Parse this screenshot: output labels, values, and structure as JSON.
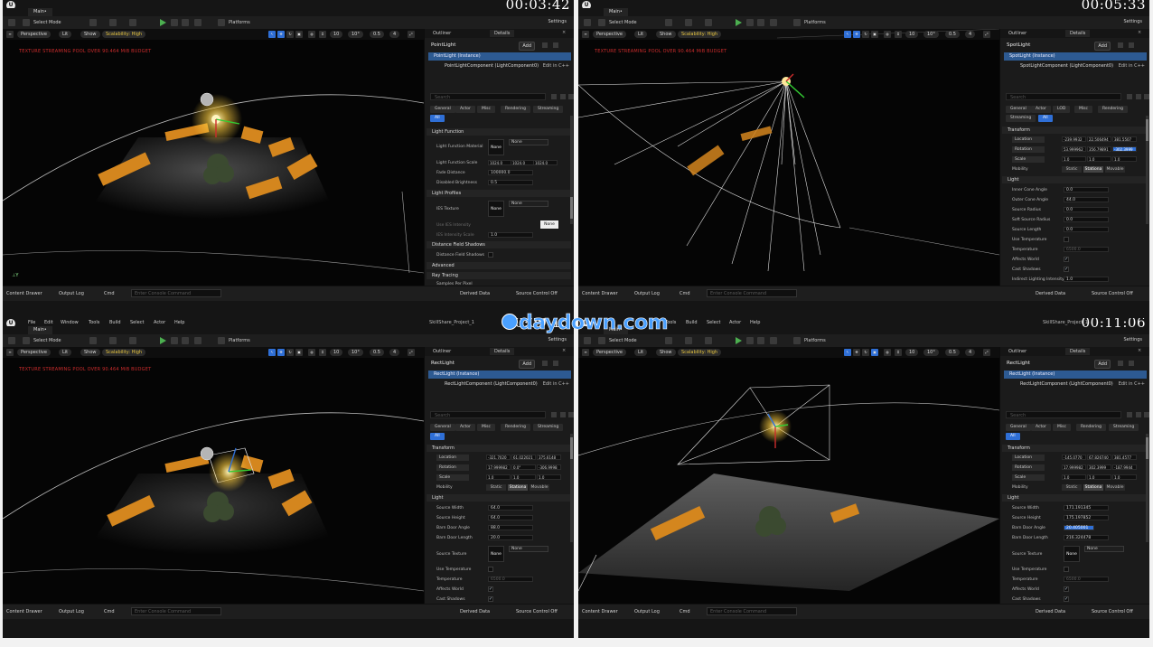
{
  "watermark": "daydown.com",
  "menu": [
    "File",
    "Edit",
    "Window",
    "Tools",
    "Build",
    "Select",
    "Actor",
    "Help"
  ],
  "project": "SkillShare_Project_1",
  "level_tab": "Main•",
  "toolbar": {
    "select_mode": "Select Mode",
    "platforms": "Platforms",
    "settings": "Settings"
  },
  "viewport": {
    "perspective": "Perspective",
    "lit": "Lit",
    "show": "Show",
    "scalability": "Scalability: High",
    "grid": "10",
    "angle": "10°",
    "scale": "0.5",
    "cam_speed": "4",
    "warning": "TEXTURE STREAMING POOL OVER 90.464 MiB BUDGET"
  },
  "panel": {
    "outliner": "Outliner",
    "details": "Details",
    "add": "Add",
    "search_placeholder": "Search",
    "edit_in_cpp": "Edit in C++"
  },
  "status": {
    "content_drawer": "Content Drawer",
    "output_log": "Output Log",
    "cmd": "Cmd",
    "console_placeholder": "Enter Console Command",
    "derived_data": "Derived Data",
    "source_control": "Source Control Off"
  },
  "colors": {
    "selection_blue": "#2d5a92",
    "accent_blue": "#2f6fd6",
    "warning_red": "#cc2c2c",
    "scalability_yellow": "#e8c640"
  },
  "quadrants": [
    {
      "timer": "00:03:42",
      "actor": "PointLight",
      "instance": "PointLight (Instance)",
      "component": "PointLightComponent (LightComponent0)",
      "filters": [
        "General",
        "Actor",
        "Misc",
        "Rendering",
        "Streaming",
        "All"
      ],
      "sections": {
        "light_function": "Light Function",
        "light_profiles": "Light Profiles",
        "dfs": "Distance Field Shadows",
        "advanced": "Advanced",
        "ray_tracing": "Ray Tracing"
      },
      "props": {
        "lf_material": "Light Function Material",
        "none": "None",
        "lf_scale": "Light Function Scale",
        "lf_scale_vals": [
          "1024.0",
          "1024.0",
          "1024.0"
        ],
        "fade": "Fade Distance",
        "fade_val": "100000.0",
        "disabled_brightness": "Disabled Brightness",
        "db_val": "0.5",
        "ies": "IES Texture",
        "use_ies": "Use IES Intensity",
        "ies_scale": "IES Intensity Scale",
        "ies_scale_val": "1.0",
        "dfs_prop": "Distance Field Shadows",
        "samples": "Samples Per Pixel",
        "samples_val": "1"
      },
      "tooltip": "None"
    },
    {
      "timer": "00:05:33",
      "actor": "SpotLight",
      "instance": "SpotLight (Instance)",
      "component": "SpotLightComponent (LightComponent0)",
      "filters": [
        "General",
        "Actor",
        "LOD",
        "Misc",
        "Rendering",
        "Streaming",
        "All"
      ],
      "transform": {
        "label": "Transform",
        "location": "Location",
        "location_vals": [
          "-239.9932",
          "22.506494",
          "381.5507"
        ],
        "rotation": "Rotation",
        "rotation_vals": [
          "53.999962",
          "356.79891",
          "-302.3999"
        ],
        "scale": "Scale",
        "scale_vals": [
          "1.0",
          "1.0",
          "1.0"
        ],
        "mobility": "Mobility",
        "mobility_vals": [
          "Static",
          "Stationa",
          "Movable"
        ]
      },
      "light": {
        "label": "Light",
        "inner": "Inner Cone Angle",
        "inner_val": "0.0",
        "outer": "Outer Cone Angle",
        "outer_val": "44.0",
        "radius": "Source Radius",
        "radius_val": "0.0",
        "soft": "Soft Source Radius",
        "soft_val": "0.0",
        "length": "Source Length",
        "length_val": "0.0",
        "use_temp": "Use Temperature",
        "temp": "Temperature",
        "temp_val": "6500.0",
        "affects": "Affects World",
        "cast": "Cast Shadows",
        "indirect": "Indirect Lighting Intensity",
        "indirect_val": "1.0"
      }
    },
    {
      "timer": "00:09:15",
      "actor": "RectLight",
      "instance": "RectLight (Instance)",
      "component": "RectLightComponent (LightComponent0)",
      "filters": [
        "General",
        "Actor",
        "Misc",
        "Rendering",
        "Streaming",
        "All"
      ],
      "transform": {
        "label": "Transform",
        "location": "Location",
        "location_vals": [
          "-321.7020",
          "61.022021",
          "375.6148"
        ],
        "rotation": "Rotation",
        "rotation_vals": [
          "17.999982",
          "0.0°",
          "-306.9998"
        ],
        "scale": "Scale",
        "scale_vals": [
          "1.0",
          "1.0",
          "1.0"
        ],
        "mobility": "Mobility",
        "mobility_vals": [
          "Static",
          "Stationa",
          "Movable"
        ]
      },
      "light": {
        "label": "Light",
        "width": "Source Width",
        "width_val": "64.0",
        "height": "Source Height",
        "height_val": "64.0",
        "barn_angle": "Barn Door Angle",
        "barn_angle_val": "88.0",
        "barn_length": "Barn Door Length",
        "barn_length_val": "20.0",
        "texture": "Source Texture",
        "none": "None",
        "use_temp": "Use Temperature",
        "temp": "Temperature",
        "temp_val": "6500.0",
        "affects": "Affects World",
        "cast": "Cast Shadows"
      }
    },
    {
      "timer": "00:11:06",
      "actor": "RectLight",
      "instance": "RectLight (Instance)",
      "component": "RectLightComponent (LightComponent0)",
      "filters": [
        "General",
        "Actor",
        "Misc",
        "Rendering",
        "Streaming",
        "All"
      ],
      "transform": {
        "label": "Transform",
        "location": "Location",
        "location_vals": [
          "-145.0770",
          "67.826740",
          "381.4577"
        ],
        "rotation": "Rotation",
        "rotation_vals": [
          "17.999982",
          "302.3999",
          "-187.9944"
        ],
        "scale": "Scale",
        "scale_vals": [
          "1.0",
          "1.0",
          "1.0"
        ],
        "mobility": "Mobility",
        "mobility_vals": [
          "Static",
          "Stationa",
          "Movable"
        ]
      },
      "light": {
        "label": "Light",
        "width": "Source Width",
        "width_val": "171.191345",
        "height": "Source Height",
        "height_val": "175.197852",
        "barn_angle": "Barn Door Angle",
        "barn_angle_val": "20.405001",
        "barn_length": "Barn Door Length",
        "barn_length_val": "216.324478",
        "texture": "Source Texture",
        "none": "None",
        "use_temp": "Use Temperature",
        "temp": "Temperature",
        "temp_val": "6500.0",
        "affects": "Affects World",
        "cast": "Cast Shadows"
      }
    }
  ]
}
